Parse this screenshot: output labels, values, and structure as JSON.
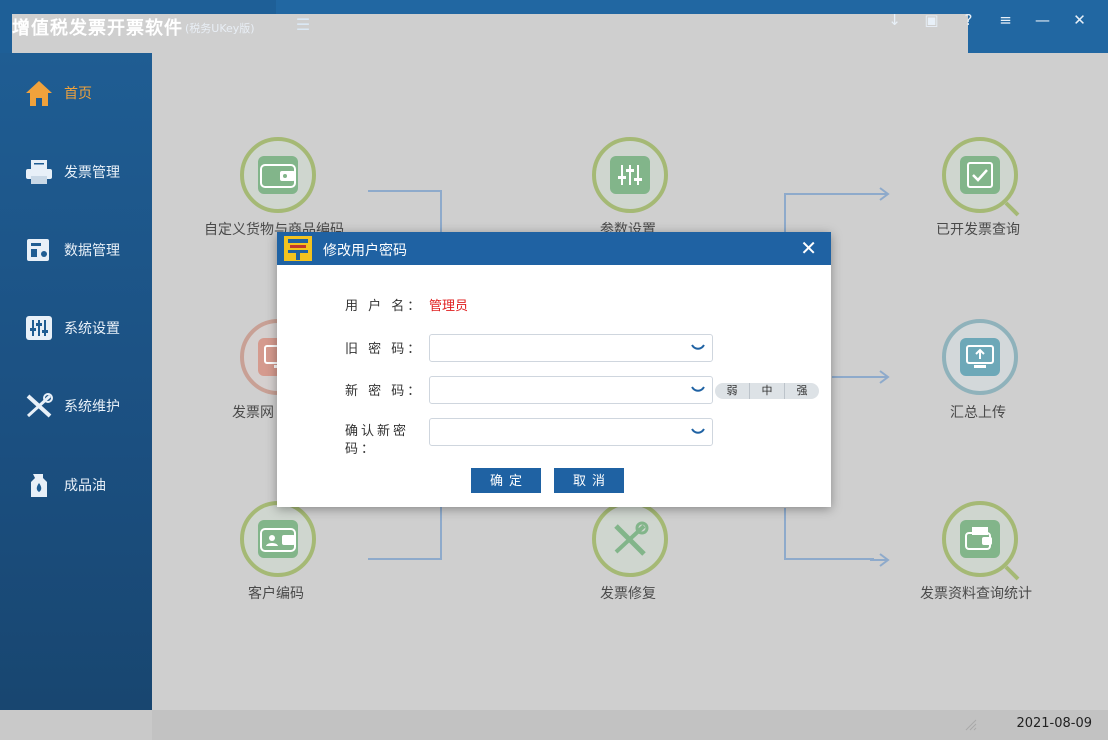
{
  "app": {
    "title": "增值税发票开票软件",
    "subtitle": "(税务UKey版)"
  },
  "window_controls": [
    "↓",
    "▣",
    "?",
    "≡",
    "—",
    "✕"
  ],
  "sidebar": {
    "items": [
      {
        "label": "首页",
        "icon": "home-icon",
        "active": true
      },
      {
        "label": "发票管理",
        "icon": "printer-icon"
      },
      {
        "label": "数据管理",
        "icon": "data-icon"
      },
      {
        "label": "系统设置",
        "icon": "settings-sliders-icon"
      },
      {
        "label": "系统维护",
        "icon": "tools-icon"
      },
      {
        "label": "成品油",
        "icon": "oil-drop-icon"
      }
    ]
  },
  "features": [
    {
      "label": "自定义货物与商品编码",
      "icon": "wallet-icon"
    },
    {
      "label": "参数设置",
      "icon": "sliders-icon"
    },
    {
      "label": "已开发票查询",
      "icon": "search-check-icon"
    },
    {
      "label": "发票网",
      "icon": "monitor-icon"
    },
    {
      "label": "汇总上传",
      "icon": "upload-monitor-icon"
    },
    {
      "label": "客户编码",
      "icon": "customer-wallet-icon"
    },
    {
      "label": "发票修复",
      "icon": "repair-tools-icon"
    },
    {
      "label": "发票资料查询统计",
      "icon": "stats-search-icon"
    }
  ],
  "dialog": {
    "title": "修改用户密码",
    "username_label": "用 户 名：",
    "username_value": "管理员",
    "old_password_label": "旧 密 码：",
    "new_password_label": "新 密 码：",
    "confirm_password_label_line1": "确认新密",
    "confirm_password_label_line2": "码：",
    "strength_levels": [
      "弱",
      "中",
      "强"
    ],
    "confirm_button": "确定",
    "cancel_button": "取消"
  },
  "status": {
    "date": "2021-08-09"
  },
  "colors": {
    "titlebar": "#2167a2",
    "sidebar": "#1c5486",
    "accent_active": "#f0a23c",
    "dialog_header": "#1f62a3",
    "username_red": "#e02020"
  }
}
